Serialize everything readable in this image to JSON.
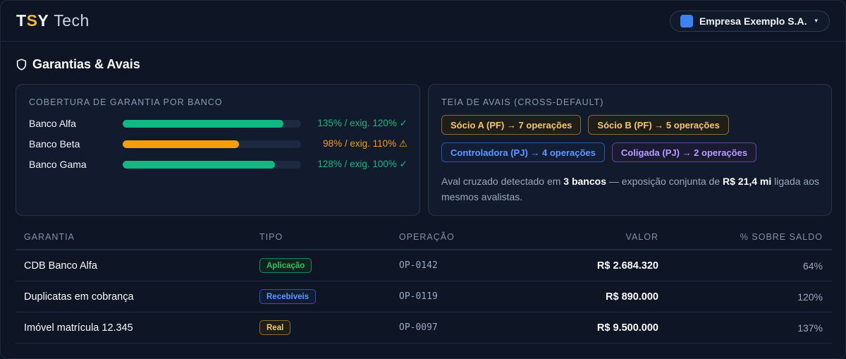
{
  "header": {
    "logo": {
      "part1": "T",
      "accent": "S",
      "part2": "Y",
      "light": "Tech"
    },
    "company": {
      "name": "Empresa Exemplo S.A.",
      "swatch_color": "#3b82f6",
      "caret": "▾"
    }
  },
  "section": {
    "title": "Garantias & Avais",
    "icon": "shield-icon"
  },
  "coverage": {
    "title": "COBERTURA DE GARANTIA POR BANCO",
    "banks": [
      {
        "name": "Banco Alfa",
        "coverage_pct": 135,
        "required_pct": 120,
        "value_text": "135% / exig. 120% ✓",
        "status": "ok",
        "color": "#10b981"
      },
      {
        "name": "Banco Beta",
        "coverage_pct": 98,
        "required_pct": 110,
        "value_text": "98% / exig. 110% ⚠",
        "status": "warning",
        "color": "#f59e0b"
      },
      {
        "name": "Banco Gama",
        "coverage_pct": 128,
        "required_pct": 100,
        "value_text": "128% / exig. 100% ✓",
        "status": "ok",
        "color": "#10b981"
      }
    ]
  },
  "avais": {
    "title": "TEIA DE AVAIS (CROSS-DEFAULT)",
    "chips": [
      {
        "label": "Sócio A (PF) → 7 operações",
        "kind": "pf"
      },
      {
        "label": "Sócio B (PF) → 5 operações",
        "kind": "pf"
      },
      {
        "label": "Controladora (PJ) → 4 operações",
        "kind": "pj"
      },
      {
        "label": "Coligada (PJ) → 2 operações",
        "kind": "col"
      }
    ],
    "summary": {
      "prefix": "Aval cruzado detectado em ",
      "banks": "3 bancos",
      "middle": " — exposição conjunta de ",
      "amount": "R$ 21,4 mi",
      "suffix": " ligada aos mesmos avalistas."
    }
  },
  "table": {
    "headers": {
      "garantia": "GARANTIA",
      "tipo": "TIPO",
      "operacao": "OPERAÇÃO",
      "valor": "VALOR",
      "pct": "% SOBRE SALDO"
    },
    "rows": [
      {
        "garantia": "CDB Banco Alfa",
        "tipo": "Aplicação",
        "tipo_kind": "aplic",
        "operacao": "OP-0142",
        "valor": "R$ 2.684.320",
        "pct": "64%"
      },
      {
        "garantia": "Duplicatas em cobrança",
        "tipo": "Recebíveis",
        "tipo_kind": "receb",
        "operacao": "OP-0119",
        "valor": "R$ 890.000",
        "pct": "120%"
      },
      {
        "garantia": "Imóvel matrícula 12.345",
        "tipo": "Real",
        "tipo_kind": "real",
        "operacao": "OP-0097",
        "valor": "R$ 9.500.000",
        "pct": "137%"
      }
    ]
  }
}
